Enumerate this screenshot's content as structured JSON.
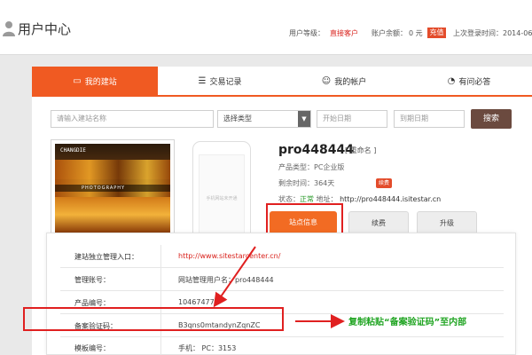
{
  "header": {
    "title": "用户中心",
    "level_label": "用户等级：",
    "level_value": "直接客户",
    "balance_label": "账户余额：",
    "balance_value": "0 元",
    "recharge_label": "充值",
    "last_login": "上次登录时间：2014-06"
  },
  "tabs": [
    {
      "label": "我的建站",
      "icon": "window-icon",
      "active": true
    },
    {
      "label": "交易记录",
      "icon": "list-icon",
      "active": false
    },
    {
      "label": "我的帐户",
      "icon": "user-icon",
      "active": false
    },
    {
      "label": "有问必答",
      "icon": "chat-icon",
      "active": false
    }
  ],
  "filters": {
    "site_name_placeholder": "请输入建站名称",
    "type_select": "选择类型",
    "start_date_placeholder": "开始日期",
    "end_date_placeholder": "到期日期",
    "search_label": "搜索"
  },
  "site": {
    "thumb_logo": "CHANGDIE",
    "thumb_caption": "PHOTOGRAPHY",
    "mobile_label": "手机网站未开通",
    "name": "pro448444",
    "rename": "[ 重命名 ]",
    "product_type": "产品类型：PC企业版",
    "remaining": "剩余时间：364天",
    "renew_badge": "续费",
    "status_label": "状态：",
    "status_value": "正常",
    "address_label": "地址：",
    "address_value": "http://pro448444.isitestar.cn"
  },
  "buttons": {
    "site_info": "站点信息",
    "renew": "续费",
    "upgrade": "升级"
  },
  "details": {
    "rows": [
      {
        "label": "建站独立管理入口：",
        "value": "http://www.sitestarcenter.cn/"
      },
      {
        "label": "管理账号：",
        "value": "网站管理用户名：pro448444"
      },
      {
        "label": "产品编号：",
        "value": "10467477"
      },
      {
        "label": "备案验证码：",
        "value": "B3qns0mtandynZqnZC"
      },
      {
        "label": "模板编号：",
        "value": "手机：    PC：3153"
      }
    ]
  },
  "annotation": "复制粘贴“备案验证码”至内部"
}
